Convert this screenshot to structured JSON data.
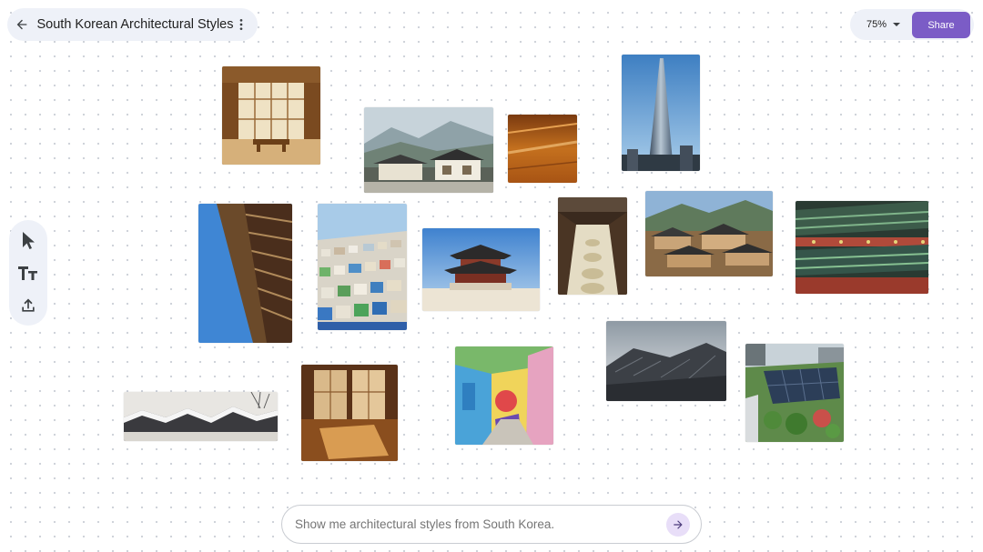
{
  "header": {
    "title": "South Korean Architectural Styles",
    "back_icon": "arrow-left-icon",
    "menu_icon": "more-vert-icon"
  },
  "zoom": {
    "value": "75%"
  },
  "share": {
    "label": "Share",
    "color": "#7b5cc6"
  },
  "toolbar": {
    "tools": [
      "select-tool",
      "text-tool",
      "upload-tool"
    ]
  },
  "images": [
    "hanok-room-interior",
    "modern-hanok-village-mountains",
    "wooden-floor-closeup",
    "lotte-world-tower",
    "traditional-eaves-closeup",
    "gamcheon-hillside-village",
    "gyeongbokgung-pavilion",
    "hanok-courtyard-stepping-stones",
    "hanok-village-rooftops",
    "palace-dancheong-eaves",
    "snow-covered-tiled-roofs",
    "hanok-interior-sunlight",
    "colorful-mural-alley",
    "hanok-tiled-roof-sky",
    "rooftop-garden-solar-panels"
  ],
  "prompt": {
    "placeholder": "Show me architectural styles from South Korea."
  }
}
